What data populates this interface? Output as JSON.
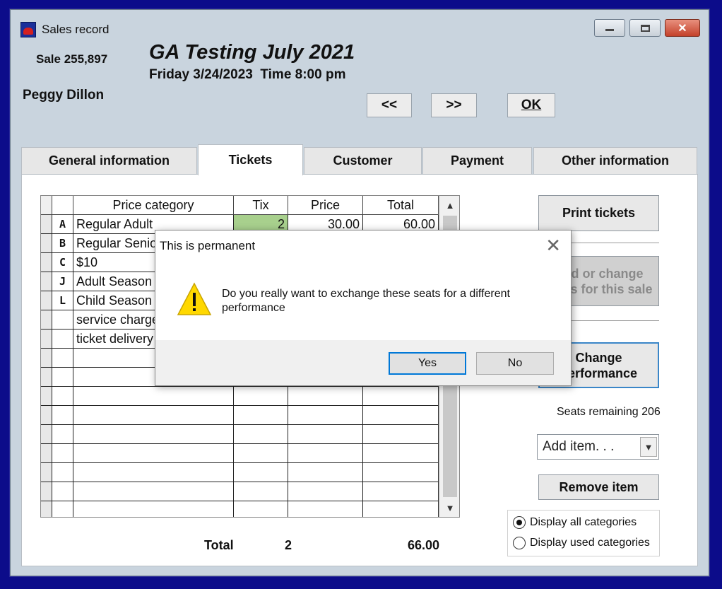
{
  "window": {
    "title": "Sales record",
    "sale_number": "Sale 255,897",
    "customer_name": "Peggy Dillon",
    "event_title": "GA Testing July 2021",
    "event_date": "Friday 3/24/2023  Time 8:00 pm"
  },
  "nav": {
    "prev": "<<",
    "next": ">>",
    "ok": "OK"
  },
  "tabs": [
    {
      "label": "General information"
    },
    {
      "label": "Tickets",
      "active": true
    },
    {
      "label": "Customer"
    },
    {
      "label": "Payment"
    },
    {
      "label": "Other information"
    }
  ],
  "grid": {
    "headers": [
      "Price category",
      "Tix",
      "Price",
      "Total"
    ],
    "rows": [
      {
        "code": "A",
        "category": "Regular Adult",
        "tix": "2",
        "price": "30.00",
        "total": "60.00"
      },
      {
        "code": "B",
        "category": "Regular Senior",
        "tix": "",
        "price": "",
        "total": ""
      },
      {
        "code": "C",
        "category": "$10",
        "tix": "",
        "price": "",
        "total": ""
      },
      {
        "code": "J",
        "category": "Adult Season",
        "tix": "",
        "price": "",
        "total": ""
      },
      {
        "code": "L",
        "category": "Child Season",
        "tix": "",
        "price": "",
        "total": ""
      },
      {
        "code": "",
        "category": "service charge",
        "tix": "",
        "price": "",
        "total": ""
      },
      {
        "code": "",
        "category": "ticket delivery",
        "tix": "",
        "price": "",
        "total": ""
      },
      {
        "code": "",
        "category": "",
        "tix": "",
        "price": "",
        "total": ""
      },
      {
        "code": "",
        "category": "",
        "tix": "",
        "price": "",
        "total": ""
      },
      {
        "code": "",
        "category": "",
        "tix": "",
        "price": "",
        "total": ""
      },
      {
        "code": "",
        "category": "",
        "tix": "",
        "price": "",
        "total": ""
      },
      {
        "code": "",
        "category": "",
        "tix": "",
        "price": "",
        "total": ""
      },
      {
        "code": "",
        "category": "",
        "tix": "",
        "price": "",
        "total": ""
      },
      {
        "code": "",
        "category": "",
        "tix": "",
        "price": "",
        "total": ""
      },
      {
        "code": "",
        "category": "",
        "tix": "",
        "price": "",
        "total": ""
      },
      {
        "code": "",
        "category": "",
        "tix": "",
        "price": "",
        "total": ""
      }
    ]
  },
  "totals": {
    "label": "Total",
    "tix": "2",
    "amount": "66.00"
  },
  "side": {
    "print_tickets": "Print tickets",
    "add_change_line1": "Add or change",
    "add_change_line2": "seats for this sale",
    "change_perf_line1": "Change",
    "change_perf_line2": "performance",
    "seats_remaining": "Seats remaining 206",
    "add_item": "Add item. . .",
    "remove_item": "Remove item",
    "radio_all": "Display all categories",
    "radio_used": "Display used categories"
  },
  "dialog": {
    "title": "This is permanent",
    "message": "Do you really want to exchange these seats for a different performance",
    "yes": "Yes",
    "no": "No"
  },
  "colors": {
    "desktop": "#0c0c8a",
    "highlight_tix": "#a8d08d",
    "focus_border": "#0078d7"
  }
}
